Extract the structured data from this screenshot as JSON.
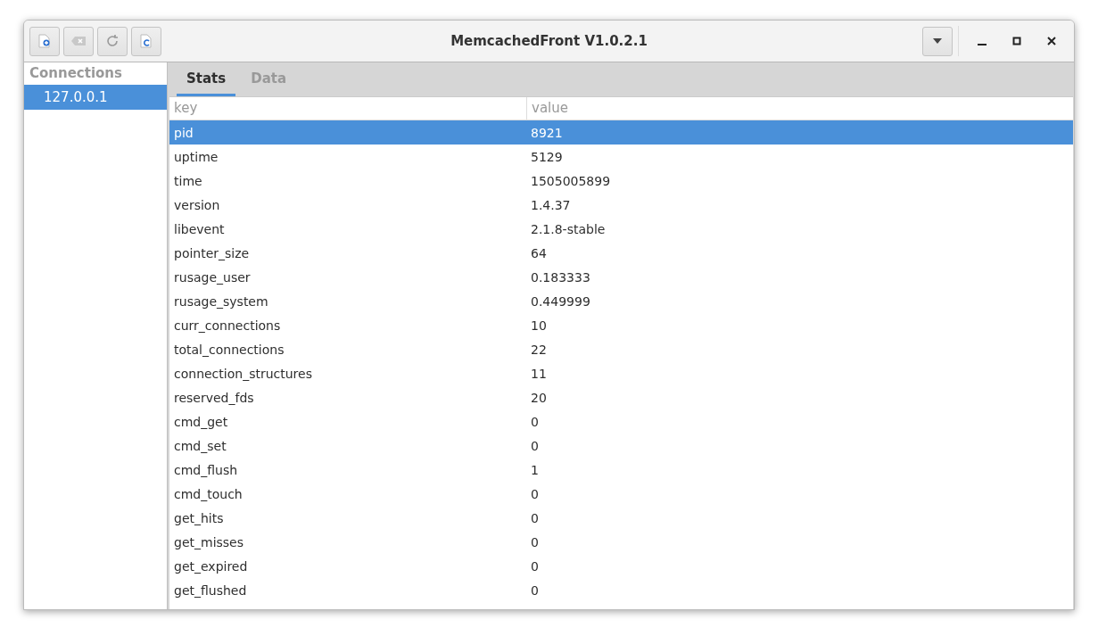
{
  "window": {
    "title": "MemcachedFront V1.0.2.1"
  },
  "sidebar": {
    "header": "Connections",
    "items": [
      {
        "label": "127.0.0.1",
        "selected": true
      }
    ]
  },
  "tabs": [
    {
      "label": "Stats",
      "selected": true
    },
    {
      "label": "Data",
      "selected": false
    }
  ],
  "table": {
    "columns": [
      "key",
      "value"
    ],
    "rows": [
      {
        "key": "pid",
        "value": "8921",
        "selected": true
      },
      {
        "key": "uptime",
        "value": "5129",
        "selected": false
      },
      {
        "key": "time",
        "value": "1505005899",
        "selected": false
      },
      {
        "key": "version",
        "value": "1.4.37",
        "selected": false
      },
      {
        "key": "libevent",
        "value": "2.1.8-stable",
        "selected": false
      },
      {
        "key": "pointer_size",
        "value": "64",
        "selected": false
      },
      {
        "key": "rusage_user",
        "value": "0.183333",
        "selected": false
      },
      {
        "key": "rusage_system",
        "value": "0.449999",
        "selected": false
      },
      {
        "key": "curr_connections",
        "value": "10",
        "selected": false
      },
      {
        "key": "total_connections",
        "value": "22",
        "selected": false
      },
      {
        "key": "connection_structures",
        "value": "11",
        "selected": false
      },
      {
        "key": "reserved_fds",
        "value": "20",
        "selected": false
      },
      {
        "key": "cmd_get",
        "value": "0",
        "selected": false
      },
      {
        "key": "cmd_set",
        "value": "0",
        "selected": false
      },
      {
        "key": "cmd_flush",
        "value": "1",
        "selected": false
      },
      {
        "key": "cmd_touch",
        "value": "0",
        "selected": false
      },
      {
        "key": "get_hits",
        "value": "0",
        "selected": false
      },
      {
        "key": "get_misses",
        "value": "0",
        "selected": false
      },
      {
        "key": "get_expired",
        "value": "0",
        "selected": false
      },
      {
        "key": "get_flushed",
        "value": "0",
        "selected": false
      }
    ]
  }
}
